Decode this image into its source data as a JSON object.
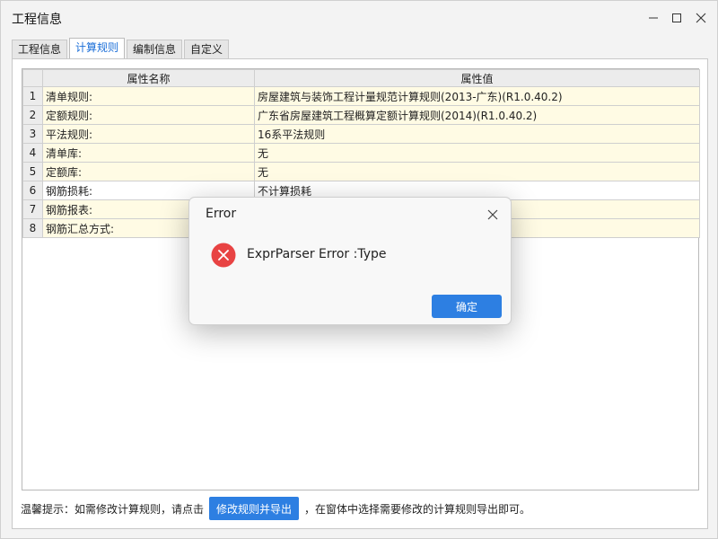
{
  "window": {
    "title": "工程信息",
    "controls": {
      "minimize": "minimize-icon",
      "maximize": "maximize-icon",
      "close": "close-icon"
    }
  },
  "tabs": [
    {
      "label": "工程信息",
      "active": false
    },
    {
      "label": "计算规则",
      "active": true
    },
    {
      "label": "编制信息",
      "active": false
    },
    {
      "label": "自定义",
      "active": false
    }
  ],
  "table": {
    "headers": [
      "属性名称",
      "属性值"
    ],
    "rows": [
      {
        "num": "1",
        "name": "清单规则:",
        "value": "房屋建筑与装饰工程计量规范计算规则(2013-广东)(R1.0.40.2)"
      },
      {
        "num": "2",
        "name": "定额规则:",
        "value": "广东省房屋建筑工程概算定额计算规则(2014)(R1.0.40.2)"
      },
      {
        "num": "3",
        "name": "平法规则:",
        "value": "16系平法规则"
      },
      {
        "num": "4",
        "name": "清单库:",
        "value": "无"
      },
      {
        "num": "5",
        "name": "定额库:",
        "value": "无"
      },
      {
        "num": "6",
        "name": "钢筋损耗:",
        "value": "不计算损耗"
      },
      {
        "num": "7",
        "name": "钢筋报表:",
        "value": ""
      },
      {
        "num": "8",
        "name": "钢筋汇总方式:",
        "value": ""
      }
    ]
  },
  "footer": {
    "prefix": "温馨提示：如需修改计算规则，请点击",
    "button_label": "修改规则并导出",
    "suffix": "，在窗体中选择需要修改的计算规则导出即可。"
  },
  "dialog": {
    "title": "Error",
    "message": "ExprParser Error :Type",
    "ok_label": "确定",
    "icon": "error-icon",
    "error_color": "#e84343",
    "accent_color": "#2d7fe2"
  }
}
